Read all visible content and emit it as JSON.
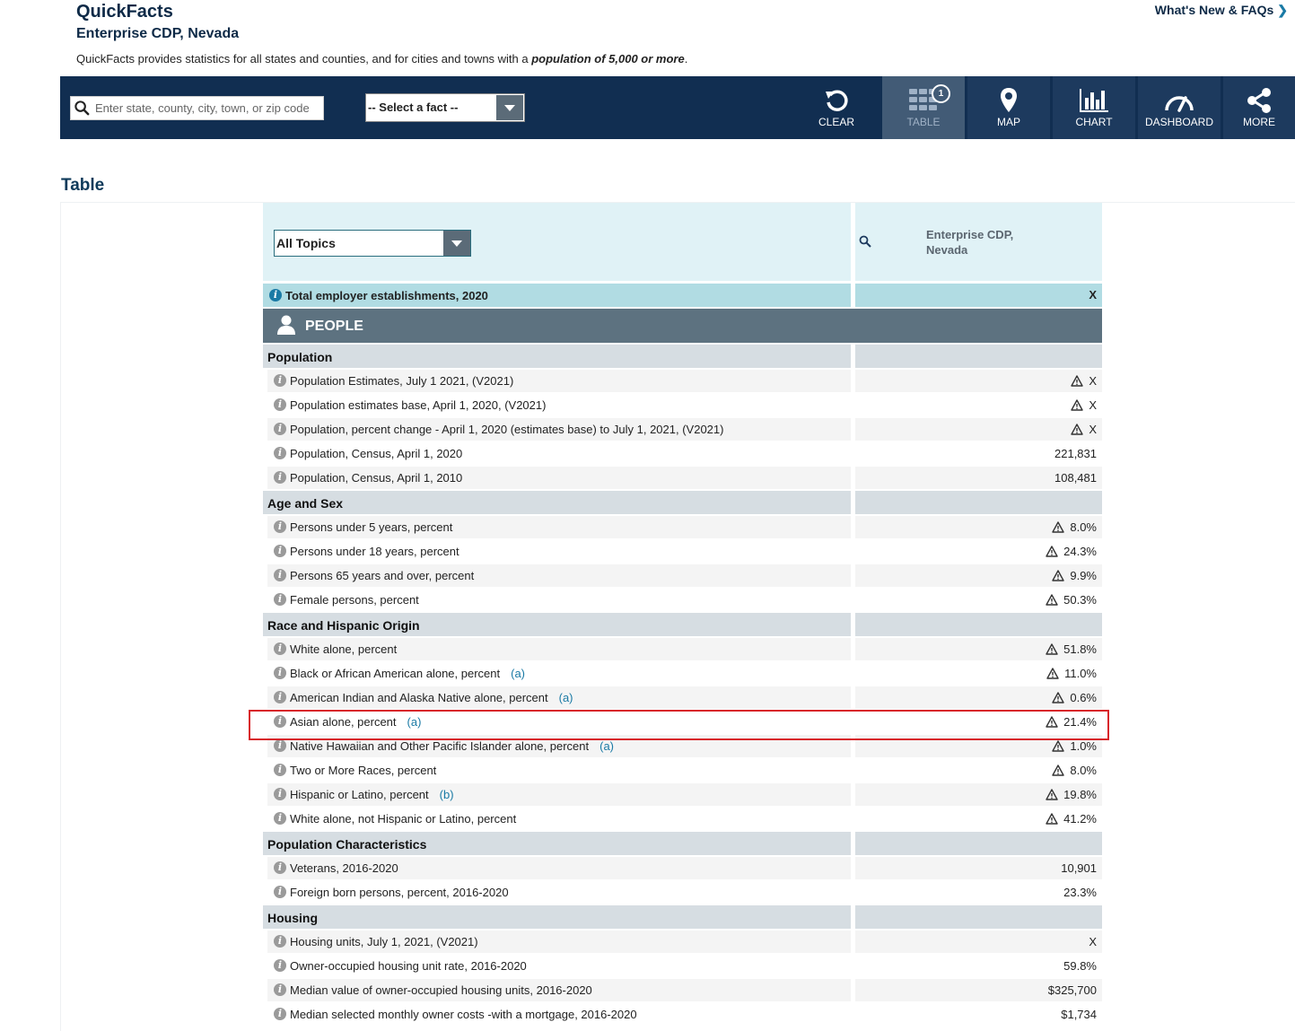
{
  "header": {
    "app_title": "QuickFacts",
    "place": "Enterprise CDP, Nevada",
    "description_prefix": "QuickFacts provides statistics for all states and counties, and for cities and towns with a ",
    "description_emphasis": "population of 5,000 or more",
    "description_suffix": ".",
    "whats_new": "What's New & FAQs"
  },
  "navbar": {
    "search_placeholder": "Enter state, county, city, town, or zip code",
    "fact_select": "-- Select a fact --",
    "buttons": {
      "clear": "CLEAR",
      "table": "TABLE",
      "table_badge": "1",
      "map": "MAP",
      "chart": "CHART",
      "dashboard": "DASHBOARD",
      "more": "MORE"
    }
  },
  "section_title": "Table",
  "table": {
    "topics_select": "All Topics",
    "geo_line1": "Enterprise CDP,",
    "geo_line2": "Nevada",
    "highlight_label": "Total employer establishments, 2020",
    "highlight_value": "X",
    "people_label": "PEOPLE",
    "groups": [
      {
        "category": "Population",
        "rows": [
          {
            "label": "Population Estimates, July 1 2021, (V2021)",
            "note": "",
            "value": "X",
            "warn": true
          },
          {
            "label": "Population estimates base, April 1, 2020, (V2021)",
            "note": "",
            "value": "X",
            "warn": true
          },
          {
            "label": "Population, percent change - April 1, 2020 (estimates base) to July 1, 2021, (V2021)",
            "note": "",
            "value": "X",
            "warn": true
          },
          {
            "label": "Population, Census, April 1, 2020",
            "note": "",
            "value": "221,831",
            "warn": false
          },
          {
            "label": "Population, Census, April 1, 2010",
            "note": "",
            "value": "108,481",
            "warn": false
          }
        ]
      },
      {
        "category": "Age and Sex",
        "rows": [
          {
            "label": "Persons under 5 years, percent",
            "note": "",
            "value": "8.0%",
            "warn": true
          },
          {
            "label": "Persons under 18 years, percent",
            "note": "",
            "value": "24.3%",
            "warn": true
          },
          {
            "label": "Persons 65 years and over, percent",
            "note": "",
            "value": "9.9%",
            "warn": true
          },
          {
            "label": "Female persons, percent",
            "note": "",
            "value": "50.3%",
            "warn": true
          }
        ]
      },
      {
        "category": "Race and Hispanic Origin",
        "rows": [
          {
            "label": "White alone, percent",
            "note": "",
            "value": "51.8%",
            "warn": true
          },
          {
            "label": "Black or African American alone, percent",
            "note": "(a)",
            "value": "11.0%",
            "warn": true
          },
          {
            "label": "American Indian and Alaska Native alone, percent",
            "note": "(a)",
            "value": "0.6%",
            "warn": true
          },
          {
            "label": "Asian alone, percent",
            "note": "(a)",
            "value": "21.4%",
            "warn": true
          },
          {
            "label": "Native Hawaiian and Other Pacific Islander alone, percent",
            "note": "(a)",
            "value": "1.0%",
            "warn": true
          },
          {
            "label": "Two or More Races, percent",
            "note": "",
            "value": "8.0%",
            "warn": true
          },
          {
            "label": "Hispanic or Latino, percent",
            "note": "(b)",
            "value": "19.8%",
            "warn": true
          },
          {
            "label": "White alone, not Hispanic or Latino, percent",
            "note": "",
            "value": "41.2%",
            "warn": true
          }
        ]
      },
      {
        "category": "Population Characteristics",
        "rows": [
          {
            "label": "Veterans, 2016-2020",
            "note": "",
            "value": "10,901",
            "warn": false
          },
          {
            "label": "Foreign born persons, percent, 2016-2020",
            "note": "",
            "value": "23.3%",
            "warn": false
          }
        ]
      },
      {
        "category": "Housing",
        "rows": [
          {
            "label": "Housing units, July 1, 2021, (V2021)",
            "note": "",
            "value": "X",
            "warn": false
          },
          {
            "label": "Owner-occupied housing unit rate, 2016-2020",
            "note": "",
            "value": "59.8%",
            "warn": false
          },
          {
            "label": "Median value of owner-occupied housing units, 2016-2020",
            "note": "",
            "value": "$325,700",
            "warn": false
          },
          {
            "label": "Median selected monthly owner costs -with a mortgage, 2016-2020",
            "note": "",
            "value": "$1,734",
            "warn": false
          }
        ]
      }
    ]
  },
  "colors": {
    "navbar": "#112e51",
    "highlight_box": "#d8232a",
    "header_bg": "#e0f2f6",
    "people_bar": "#5d7280"
  }
}
